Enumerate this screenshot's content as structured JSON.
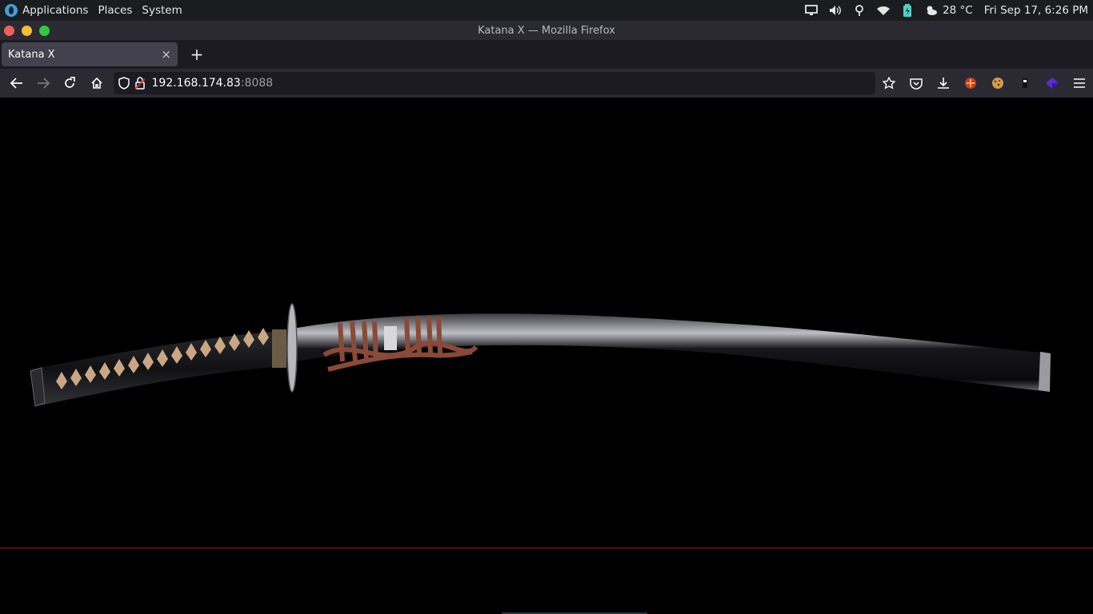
{
  "system_panel": {
    "menu": [
      "Applications",
      "Places",
      "System"
    ],
    "temperature": "28 °C",
    "clock": "Fri Sep 17,  6:26 PM"
  },
  "window": {
    "title": "Katana X — Mozilla Firefox"
  },
  "tabs": [
    {
      "label": "Katana X",
      "close": "×"
    }
  ],
  "new_tab_label": "+",
  "urlbar": {
    "host": "192.168.174.83",
    "port": ":8088"
  },
  "content": {
    "image": "katana-sword-image",
    "background": "#000000",
    "divider_color": "#a3141b"
  },
  "colors": {
    "close": "#ec5f5d",
    "minimize": "#f3be2f",
    "maximize": "#2fc840",
    "accent": "#3ea0dc"
  }
}
